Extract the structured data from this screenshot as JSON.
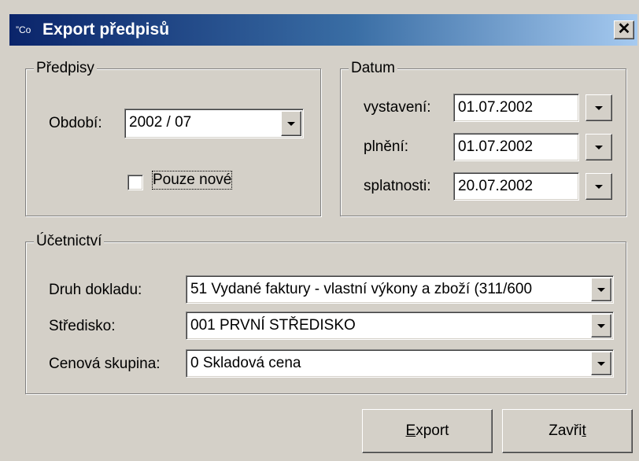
{
  "window": {
    "title": "Export předpisů",
    "icon": "app-icon",
    "icon_text": "”Co",
    "close_label": "✕"
  },
  "predpisy": {
    "group_label": "Předpisy",
    "obdobi_label": "Období:",
    "obdobi_value": "2002 / 07",
    "pouze_nove_label": "Pouze nové",
    "pouze_nove_checked": false
  },
  "datum": {
    "group_label": "Datum",
    "vystaveni_label": "vystavení:",
    "vystaveni_value": "01.07.2002",
    "plneni_label": "plnění:",
    "plneni_value": "01.07.2002",
    "splatnosti_label": "splatnosti:",
    "splatnosti_value": "20.07.2002"
  },
  "ucetnictvi": {
    "group_label": "Účetnictví",
    "druh_label": "Druh dokladu:",
    "druh_value": "51 Vydané faktury - vlastní výkony a zboží (311/600",
    "stredisko_label": "Středisko:",
    "stredisko_value": "001 PRVNÍ STŘEDISKO",
    "cenova_label": "Cenová skupina:",
    "cenova_value": "0 Skladová cena"
  },
  "buttons": {
    "export_label": "Export",
    "export_underline": "E",
    "export_rest": "xport",
    "zavrit_label": "Zavřít",
    "zavrit_start": "Zavři",
    "zavrit_underline": "t"
  },
  "colors": {
    "titlebar_start": "#0a246a",
    "titlebar_end": "#a6caf0",
    "face": "#d4d0c8"
  }
}
